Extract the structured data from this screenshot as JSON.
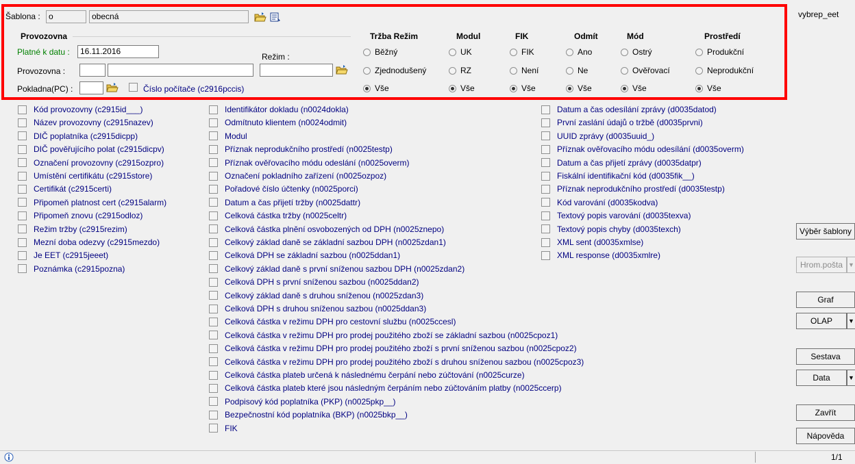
{
  "header": {
    "template_label": "Šablona :",
    "template_code": "o",
    "template_name": "obecná",
    "report_name": "vybrep_eet"
  },
  "provozovna": {
    "title": "Provozovna",
    "date_label": "Platné k datu :",
    "date_value": "16.11.2016",
    "regime_label": "Režim :",
    "provozovna_label": "Provozovna :",
    "pokladna_label": "Pokladna(PC) :",
    "pc_checkbox_label": "Číslo počítače (c2916pccis)"
  },
  "groups": [
    {
      "title": "Tržba Režim",
      "options": [
        "Běžný",
        "Zjednodušený",
        "Vše"
      ],
      "selected": 2
    },
    {
      "title": "Modul",
      "options": [
        "UK",
        "RZ",
        "Vše"
      ],
      "selected": 2
    },
    {
      "title": "FIK",
      "options": [
        "FIK",
        "Není",
        "Vše"
      ],
      "selected": 2
    },
    {
      "title": "Odmít",
      "options": [
        "Ano",
        "Ne",
        "Vše"
      ],
      "selected": 2
    },
    {
      "title": "Mód",
      "options": [
        "Ostrý",
        "Ověřovací",
        "Vše"
      ],
      "selected": 2
    },
    {
      "title": "Prostředí",
      "options": [
        "Produkční",
        "Neprodukční",
        "Vše"
      ],
      "selected": 2
    }
  ],
  "fields": {
    "col1": [
      "Kód provozovny (c2915id___)",
      "Název provozovny (c2915nazev)",
      "DIČ poplatníka (c2915dicpp)",
      "DIČ pověřujícího polat (c2915dicpv)",
      "Označení provozovny (c2915ozpro)",
      "Umístění certifikátu (c2915store)",
      "Certifikát (c2915certi)",
      "Připomeň platnost cert (c2915alarm)",
      "Připomeň znovu (c2915odloz)",
      "Režim tržby (c2915rezim)",
      "Mezní doba odezvy (c2915mezdo)",
      "Je EET (c2915jeeet)",
      "Poznámka (c2915pozna)"
    ],
    "col2": [
      "Identifikátor dokladu (n0024dokla)",
      "Odmítnuto klientem (n0024odmit)",
      "Modul",
      "Příznak neprodukčního prostředí (n0025testp)",
      "Příznak ověřovacího módu odeslání (n0025overm)",
      "Označení pokladního zařízení (n0025ozpoz)",
      "Pořadové číslo účtenky (n0025porci)",
      "Datum a čas přijetí tržby (n0025dattr)",
      "Celková částka tržby (n0025celtr)",
      "Celková částka plnění osvobozených od DPH (n0025znepo)",
      "Celkový základ daně se základní sazbou DPH (n0025zdan1)",
      "Celková DPH se základní sazbou (n0025ddan1)",
      "Celkový základ daně s první sníženou sazbou DPH (n0025zdan2)",
      "Celková DPH s první sníženou sazbou (n0025ddan2)",
      "Celkový základ daně s druhou sníženou (n0025zdan3)",
      "Celková DPH s druhou sníženou sazbou (n0025ddan3)",
      "Celková částka v režimu DPH pro cestovní službu (n0025ccesl)",
      "Celková částka v režimu DPH pro prodej použitého zboží se základní sazbou (n0025cpoz1)",
      "Celková částka v režimu DPH pro prodej použitého zboží s první sníženou sazbou (n0025cpoz2)",
      "Celková částka v režimu DPH pro prodej použitého zboží s druhou sníženou sazbou (n0025cpoz3)",
      "Celková částka plateb určená k následnému čerpání nebo zúčtování (n0025curze)",
      "Celková částka plateb které jsou následným čerpáním nebo zúčtováním platby (n0025ccerp)",
      "Podpisový kód poplatníka (PKP) (n0025pkp__)",
      "Bezpečnostní kód poplatníka (BKP) (n0025bkp__)",
      "FIK"
    ],
    "col3": [
      "Datum a čas odesílání zprávy (d0035datod)",
      "První zaslání údajů o tržbě (d0035prvni)",
      "UUID zprávy (d0035uuid_)",
      "Příznak ověřovacího módu odesílání (d0035overm)",
      "Datum a čas přijetí zprávy (d0035datpr)",
      "Fiskální identifikační kód (d0035fik__)",
      "Příznak neprodukčního prostředí (d0035testp)",
      "Kód varování (d0035kodva)",
      "Textový popis varování (d0035texva)",
      "Textový popis chyby (d0035texch)",
      "XML sent (d0035xmlse)",
      "XML response (d0035xmlre)"
    ]
  },
  "sidebar": {
    "vyber_sablony": "Výběr šablony",
    "hrom_posta": "Hrom.pošta",
    "graf": "Graf",
    "olap": "OLAP",
    "sestava": "Sestava",
    "data": "Data",
    "zavrit": "Zavřít",
    "napoveda": "Nápověda"
  },
  "status": {
    "page": "1/1"
  }
}
